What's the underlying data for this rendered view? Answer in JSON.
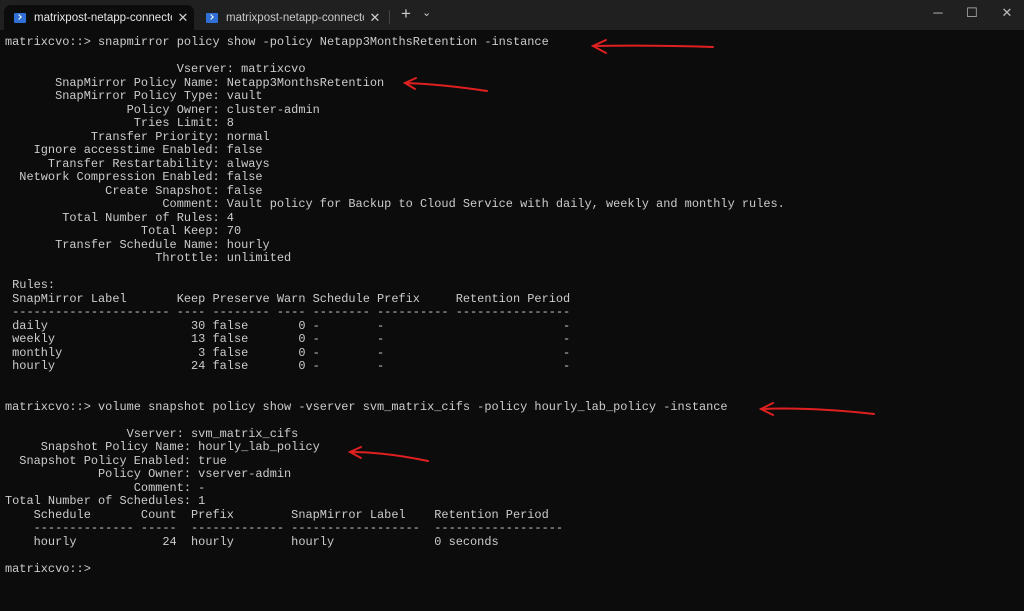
{
  "tabs": [
    {
      "title": "matrixpost-netapp-connector",
      "active": true
    },
    {
      "title": "matrixpost-netapp-connector(",
      "active": false
    }
  ],
  "icons": {
    "tab_icon": "powershell-icon",
    "close": "close-icon",
    "new_tab": "plus-icon",
    "dropdown": "chevron-down-icon"
  },
  "window_controls": {
    "minimize": "─",
    "maximize": "☐",
    "close": "✕"
  },
  "colors": {
    "background": "#0c0c0c",
    "text": "#cccccc",
    "annotation": "#e02020"
  },
  "terminal": {
    "lines": [
      "matrixcvo::> snapmirror policy show -policy Netapp3MonthsRetention -instance",
      "",
      "                        Vserver: matrixcvo",
      "       SnapMirror Policy Name: Netapp3MonthsRetention",
      "       SnapMirror Policy Type: vault",
      "                 Policy Owner: cluster-admin",
      "                  Tries Limit: 8",
      "            Transfer Priority: normal",
      "    Ignore accesstime Enabled: false",
      "      Transfer Restartability: always",
      "  Network Compression Enabled: false",
      "              Create Snapshot: false",
      "                      Comment: Vault policy for Backup to Cloud Service with daily, weekly and monthly rules.",
      "        Total Number of Rules: 4",
      "                   Total Keep: 70",
      "       Transfer Schedule Name: hourly",
      "                     Throttle: unlimited",
      "",
      " Rules:",
      " SnapMirror Label       Keep Preserve Warn Schedule Prefix     Retention Period",
      " ---------------------- ---- -------- ---- -------- ---------- ----------------",
      " daily                    30 false       0 -        -                         -",
      " weekly                   13 false       0 -        -                         -",
      " monthly                   3 false       0 -        -                         -",
      " hourly                   24 false       0 -        -                         -",
      "",
      "",
      "matrixcvo::> volume snapshot policy show -vserver svm_matrix_cifs -policy hourly_lab_policy -instance",
      "",
      "                 Vserver: svm_matrix_cifs",
      "     Snapshot Policy Name: hourly_lab_policy",
      "  Snapshot Policy Enabled: true",
      "             Policy Owner: vserver-admin",
      "                  Comment: -",
      "Total Number of Schedules: 1",
      "    Schedule       Count  Prefix        SnapMirror Label    Retention Period",
      "    -------------- -----  ------------- ------------------  ------------------",
      "    hourly            24  hourly        hourly              0 seconds",
      "",
      "matrixcvo::>"
    ]
  }
}
